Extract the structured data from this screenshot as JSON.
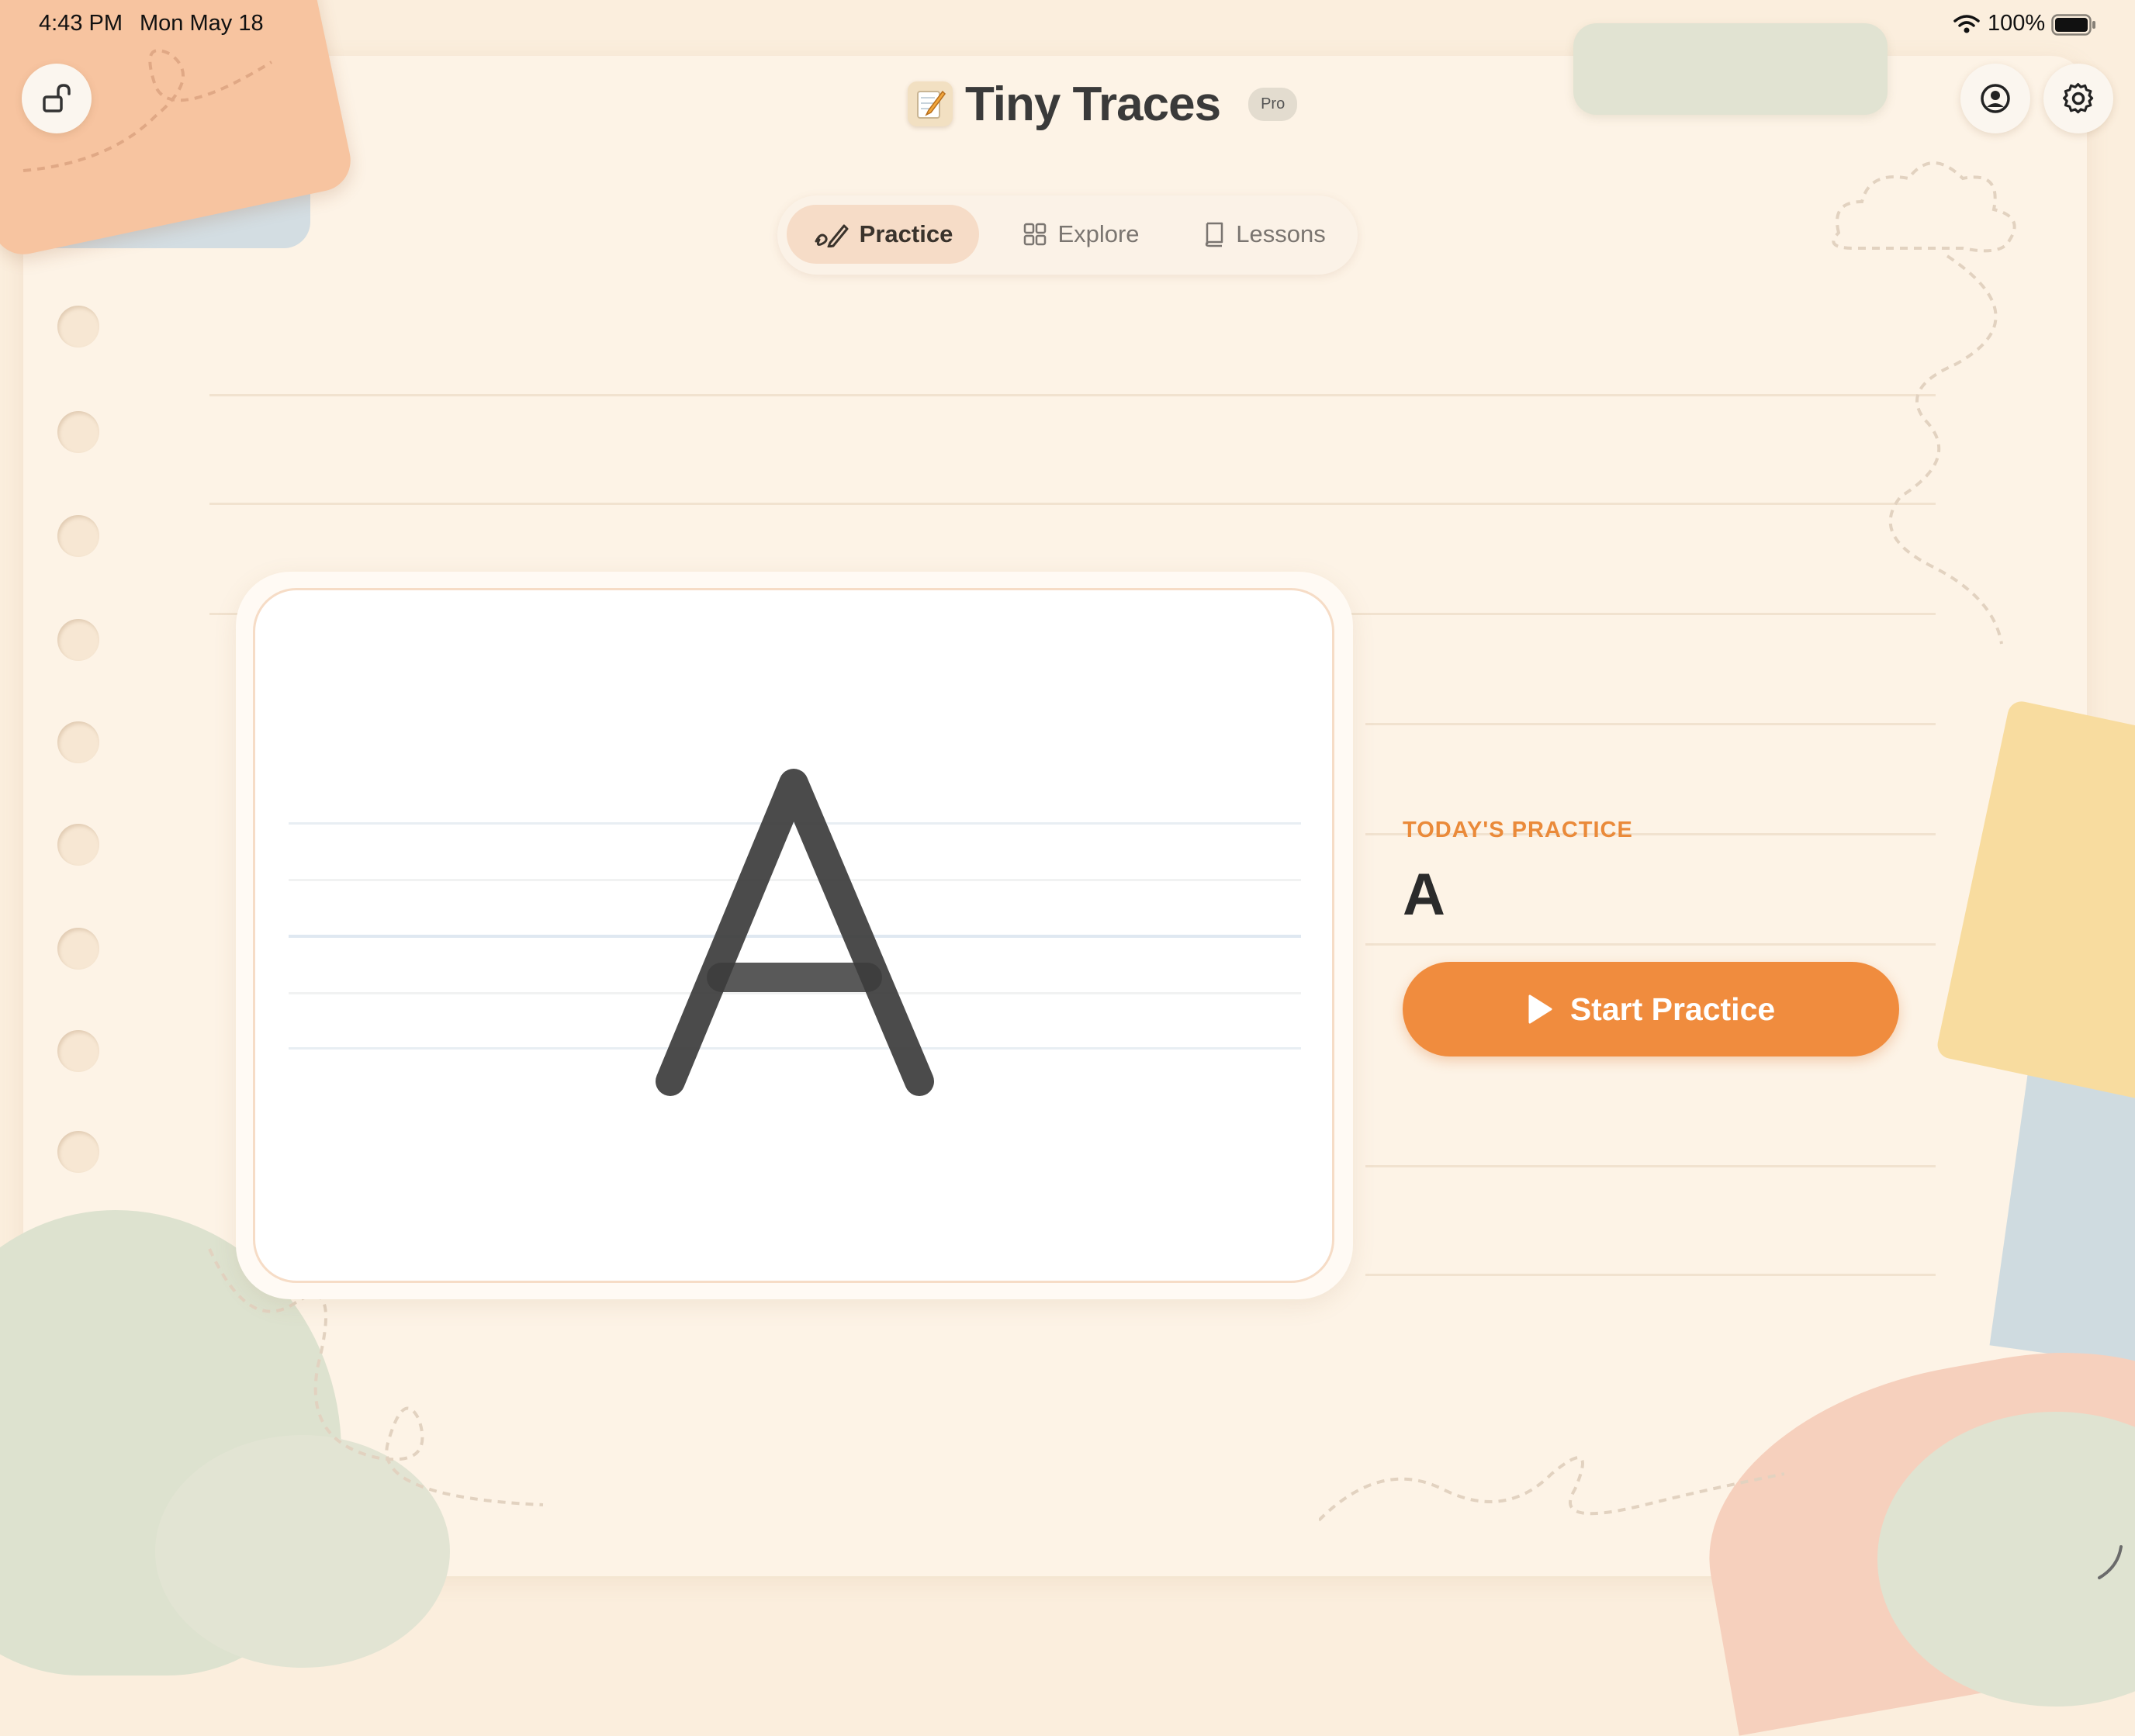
{
  "status_bar": {
    "time": "4:43 PM",
    "date": "Mon May 18",
    "battery": "100%"
  },
  "header": {
    "app_title": "Tiny Traces",
    "badge": "Pro",
    "icons": [
      "unlock-icon",
      "account-icon",
      "gear-icon"
    ]
  },
  "tabs": [
    {
      "label": "Practice",
      "icon": "pencil-icon",
      "active": true
    },
    {
      "label": "Explore",
      "icon": "grid-icon",
      "active": false
    },
    {
      "label": "Lessons",
      "icon": "book-icon",
      "active": false
    }
  ],
  "trace_card": {
    "letter": "A"
  },
  "practice_panel": {
    "label": "TODAY'S PRACTICE",
    "letter": "A",
    "start_label": "Start Practice"
  },
  "colors": {
    "accent": "#f08c3e",
    "background": "#fbeedd",
    "tab_active": "#f6dcc7"
  }
}
